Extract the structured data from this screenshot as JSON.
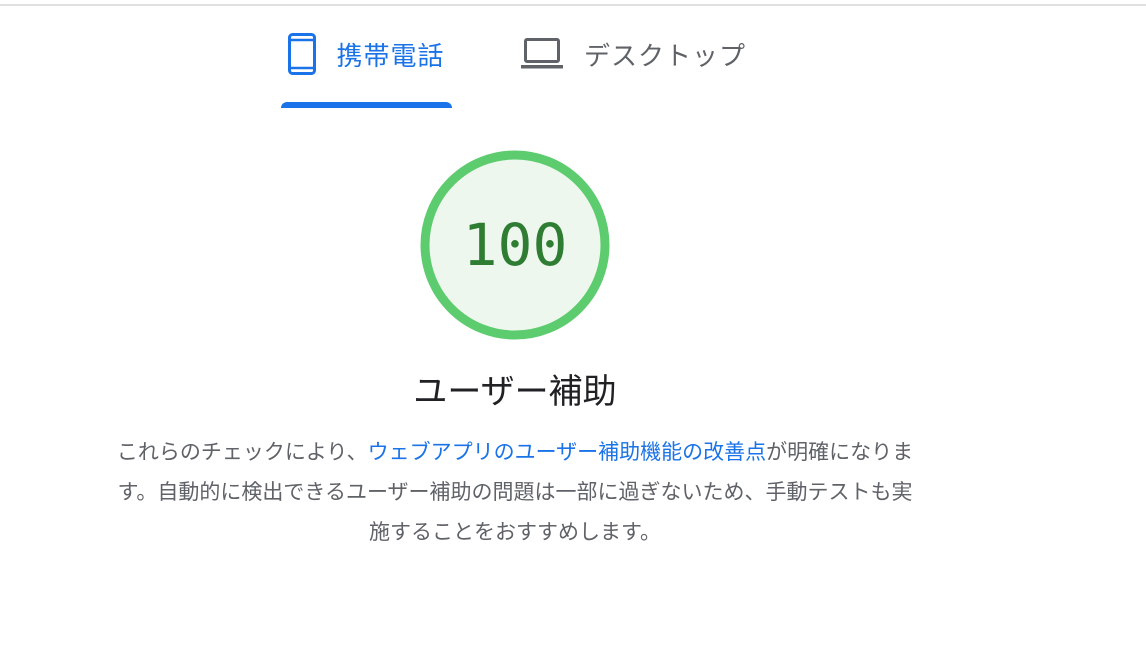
{
  "tabs": {
    "mobile": {
      "label": "携帯電話",
      "icon": "smartphone-icon",
      "selected": true
    },
    "desktop": {
      "label": "デスクトップ",
      "icon": "laptop-icon",
      "selected": false
    }
  },
  "gauge": {
    "score": "100",
    "colors": {
      "ring": "#5ccc6e",
      "fill": "#eef7ee",
      "text": "#2e7d32"
    }
  },
  "category": {
    "title": "ユーザー補助"
  },
  "description": {
    "before": "これらのチェックにより、",
    "link": "ウェブアプリのユーザー補助機能の改善点",
    "after": "が明確になります。自動的に検出できるユーザー補助の問題は一部に過ぎないため、手動テストも実施することをおすすめします。"
  },
  "colors": {
    "accent": "#1a73e8",
    "muted": "#5f6368"
  }
}
